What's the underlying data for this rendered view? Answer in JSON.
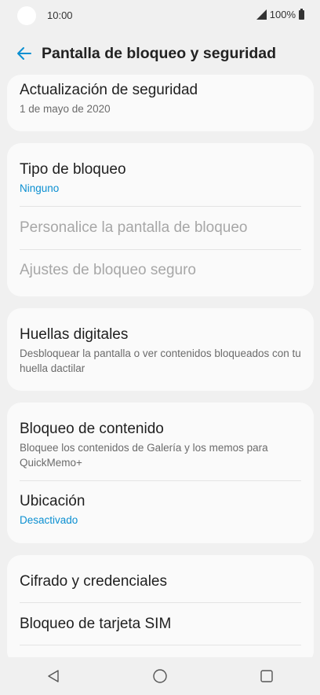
{
  "status": {
    "time": "10:00",
    "battery": "100%"
  },
  "header": {
    "title": "Pantalla de bloqueo y seguridad"
  },
  "items": {
    "security_update": {
      "title": "Actualización de seguridad",
      "sub": "1 de mayo de 2020"
    },
    "lock_type": {
      "title": "Tipo de bloqueo",
      "sub": "Ninguno"
    },
    "customize_lock": {
      "title": "Personalice la pantalla de bloqueo"
    },
    "secure_lock": {
      "title": "Ajustes de bloqueo seguro"
    },
    "fingerprints": {
      "title": "Huellas digitales",
      "sub": "Desbloquear la pantalla o ver contenidos bloqueados con tu huella dactilar"
    },
    "content_lock": {
      "title": "Bloqueo de contenido",
      "sub": "Bloquee los contenidos de Galería y los memos para QuickMemo+"
    },
    "location": {
      "title": "Ubicación",
      "sub": "Desactivado"
    },
    "encryption": {
      "title": "Cifrado y credenciales"
    },
    "sim_lock": {
      "title": "Bloqueo de tarjeta SIM"
    }
  },
  "colors": {
    "accent": "#0b8fd1",
    "background": "#f0f0f0",
    "card": "#fafafa"
  },
  "icons": {
    "back": "arrow-left-icon",
    "nav": [
      "back-triangle-icon",
      "home-circle-icon",
      "recents-square-icon"
    ]
  }
}
